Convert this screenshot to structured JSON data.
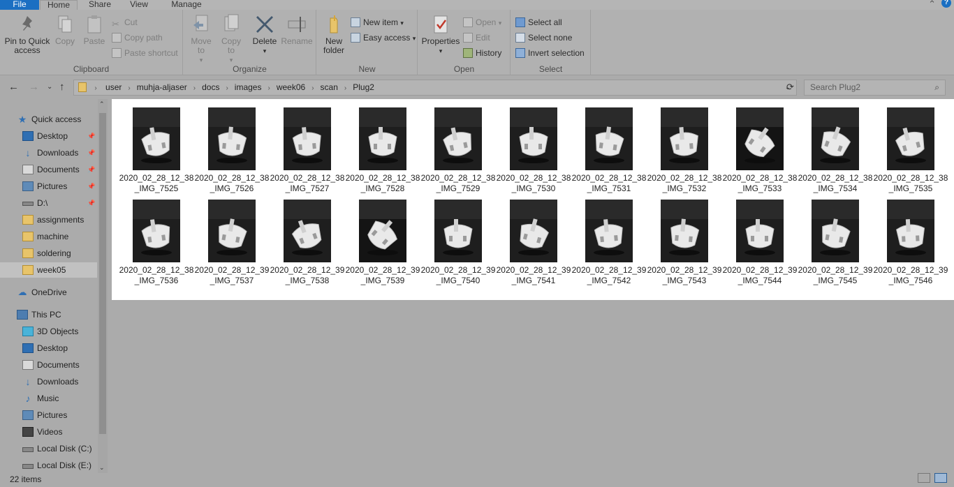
{
  "tabs": {
    "file": "File",
    "home": "Home",
    "share": "Share",
    "view": "View",
    "manage": "Manage",
    "help": "?"
  },
  "ribbon": {
    "clipboard": {
      "label": "Clipboard",
      "pin": "Pin to Quick access",
      "copy": "Copy",
      "paste": "Paste",
      "cut": "Cut",
      "copy_path": "Copy path",
      "paste_shortcut": "Paste shortcut"
    },
    "organize": {
      "label": "Organize",
      "move_to": "Move to",
      "copy_to": "Copy to",
      "delete": "Delete",
      "rename": "Rename"
    },
    "new": {
      "label": "New",
      "new_folder": "New folder",
      "new_item": "New item",
      "easy_access": "Easy access"
    },
    "open": {
      "label": "Open",
      "properties": "Properties",
      "open": "Open",
      "edit": "Edit",
      "history": "History"
    },
    "select": {
      "label": "Select",
      "select_all": "Select all",
      "select_none": "Select none",
      "invert": "Invert selection"
    }
  },
  "address": {
    "crumbs": [
      "user",
      "muhja-aljaser",
      "docs",
      "images",
      "week06",
      "scan",
      "Plug2"
    ],
    "search_placeholder": "Search Plug2"
  },
  "sidebar": {
    "quick_access": "Quick access",
    "pinned": [
      {
        "label": "Desktop",
        "icon": "desktop-icon"
      },
      {
        "label": "Downloads",
        "icon": "downloads-icon"
      },
      {
        "label": "Documents",
        "icon": "documents-icon"
      },
      {
        "label": "Pictures",
        "icon": "pictures-icon"
      },
      {
        "label": "D:\\",
        "icon": "drive-icon"
      }
    ],
    "folders": [
      "assignments",
      "machine",
      "soldering",
      "week05"
    ],
    "onedrive": "OneDrive",
    "this_pc": "This PC",
    "pc_items": [
      {
        "label": "3D Objects",
        "icon": "3d-objects-icon"
      },
      {
        "label": "Desktop",
        "icon": "desktop-icon"
      },
      {
        "label": "Documents",
        "icon": "documents-icon"
      },
      {
        "label": "Downloads",
        "icon": "downloads-icon"
      },
      {
        "label": "Music",
        "icon": "music-icon"
      },
      {
        "label": "Pictures",
        "icon": "pictures-icon"
      },
      {
        "label": "Videos",
        "icon": "videos-icon"
      },
      {
        "label": "Local Disk (C:)",
        "icon": "local-disk-icon"
      },
      {
        "label": "Local Disk (E:)",
        "icon": "local-disk-icon"
      }
    ]
  },
  "files": [
    {
      "line1": "2020_02_28_12_38",
      "line2": "_IMG_7525"
    },
    {
      "line1": "2020_02_28_12_38",
      "line2": "_IMG_7526"
    },
    {
      "line1": "2020_02_28_12_38",
      "line2": "_IMG_7527"
    },
    {
      "line1": "2020_02_28_12_38",
      "line2": "_IMG_7528"
    },
    {
      "line1": "2020_02_28_12_38",
      "line2": "_IMG_7529"
    },
    {
      "line1": "2020_02_28_12_38",
      "line2": "_IMG_7530"
    },
    {
      "line1": "2020_02_28_12_38",
      "line2": "_IMG_7531"
    },
    {
      "line1": "2020_02_28_12_38",
      "line2": "_IMG_7532"
    },
    {
      "line1": "2020_02_28_12_38",
      "line2": "_IMG_7533"
    },
    {
      "line1": "2020_02_28_12_38",
      "line2": "_IMG_7534"
    },
    {
      "line1": "2020_02_28_12_38",
      "line2": "_IMG_7535"
    },
    {
      "line1": "2020_02_28_12_38",
      "line2": "_IMG_7536"
    },
    {
      "line1": "2020_02_28_12_39",
      "line2": "_IMG_7537"
    },
    {
      "line1": "2020_02_28_12_39",
      "line2": "_IMG_7538"
    },
    {
      "line1": "2020_02_28_12_39",
      "line2": "_IMG_7539"
    },
    {
      "line1": "2020_02_28_12_39",
      "line2": "_IMG_7540"
    },
    {
      "line1": "2020_02_28_12_39",
      "line2": "_IMG_7541"
    },
    {
      "line1": "2020_02_28_12_39",
      "line2": "_IMG_7542"
    },
    {
      "line1": "2020_02_28_12_39",
      "line2": "_IMG_7543"
    },
    {
      "line1": "2020_02_28_12_39",
      "line2": "_IMG_7544"
    },
    {
      "line1": "2020_02_28_12_39",
      "line2": "_IMG_7545"
    },
    {
      "line1": "2020_02_28_12_39",
      "line2": "_IMG_7546"
    }
  ],
  "status": {
    "count": "22 items"
  },
  "colors": {
    "accent": "#1b6fc2",
    "folder": "#e8c46a",
    "background": "#ababab"
  }
}
